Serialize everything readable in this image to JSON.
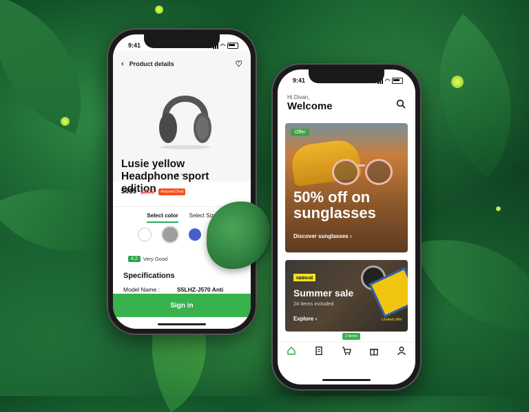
{
  "status_time": "9:41",
  "product_screen": {
    "title": "Product details",
    "product_name": "Lusie yellow Headphone sport edition",
    "price": "$615",
    "old_price": "$895",
    "badge": "Assured Deal",
    "tabs": [
      "Select color",
      "Select Size"
    ],
    "colors": [
      "#ffffff",
      "#9e9e9e",
      "#4a5ec9",
      "#f6c945"
    ],
    "rating_score": "4.2",
    "rating_label": "Very Good",
    "specs_title": "Specifications",
    "spec_key": "Model Name :",
    "spec_value": "S5LHZ-J570 Anti",
    "signin_label": "Sign in"
  },
  "home_screen": {
    "greeting": "Hi Divan,",
    "title": "Welcome",
    "offer_tag": "Offer",
    "offer_title": "50% off on sunglasses",
    "offer_link": "Discover sunglasses ›",
    "brand": "sunwat",
    "sale_title": "Summer sale",
    "sale_sub": "24 items included",
    "sale_link": "Explore ›",
    "sale_tag": "Limited offer",
    "cart_badge": "2 items",
    "tabs": [
      "home-icon",
      "document-icon",
      "cart-icon",
      "gift-icon",
      "profile-icon"
    ]
  }
}
